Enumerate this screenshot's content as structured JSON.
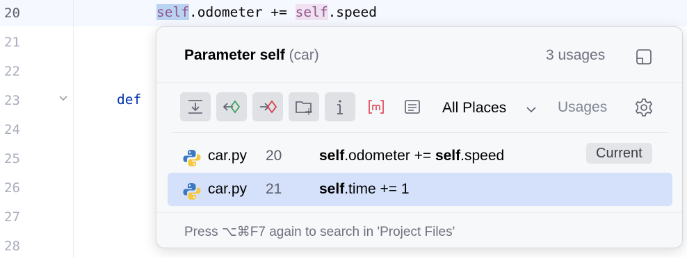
{
  "editor": {
    "line_numbers": [
      "20",
      "21",
      "22",
      "23",
      "24",
      "25",
      "26",
      "27",
      "28"
    ],
    "active_line": "20",
    "line20": {
      "self1": "self",
      "mid": ".odometer += ",
      "self2": "self",
      "end": ".speed"
    },
    "line23": {
      "keyword": "def"
    }
  },
  "popup": {
    "title_bold": "Parameter self",
    "title_sub": " (car)",
    "usage_count": "3 usages",
    "toolbar": {
      "scope": "All Places",
      "usages_label": "Usages",
      "icons": [
        "merge-usages-icon",
        "read-access-icon",
        "write-access-icon",
        "module-icon",
        "preview-icon",
        "method-usages-icon",
        "text-usages-icon"
      ]
    },
    "results": [
      {
        "file": "car.py",
        "line": "20",
        "bold1": "self",
        "text1": ".odometer += ",
        "bold2": "self",
        "text2": ".speed",
        "badge": "Current"
      },
      {
        "file": "car.py",
        "line": "21",
        "bold1": "self",
        "text1": ".time += 1"
      }
    ],
    "footer": "Press ⌥⌘F7 again to search in 'Project Files'"
  },
  "colors": {
    "selected_row": "#d5e1fb",
    "self_keyword": "#94558d",
    "def_keyword": "#0033b3",
    "write_highlight": "#b9d4f2",
    "read_highlight": "#efe1f0"
  }
}
